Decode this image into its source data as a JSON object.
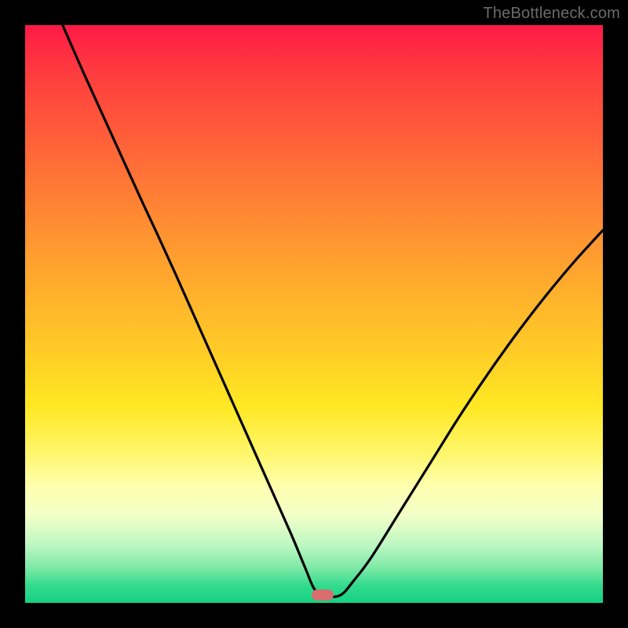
{
  "watermark": "TheBottleneck.com",
  "marker": {
    "cx_frac": 0.515,
    "cy_frac": 0.987
  },
  "chart_data": {
    "type": "line",
    "title": "",
    "xlabel": "",
    "ylabel": "",
    "xlim": [
      0,
      1
    ],
    "ylim": [
      0,
      1
    ],
    "grid": false,
    "legend": false,
    "note": "Axes are unlabeled; values are normalized fractions of the plot area (0=left/top, 1=right/bottom for rendering; bottleneck % interpreted as 1-y).",
    "series": [
      {
        "name": "bottleneck-curve",
        "x": [
          0.065,
          0.1,
          0.15,
          0.2,
          0.228,
          0.26,
          0.3,
          0.34,
          0.38,
          0.42,
          0.46,
          0.485,
          0.5,
          0.515,
          0.545,
          0.57,
          0.6,
          0.65,
          0.7,
          0.75,
          0.8,
          0.85,
          0.9,
          0.95,
          1.0
        ],
        "y": [
          0.0,
          0.08,
          0.19,
          0.3,
          0.36,
          0.43,
          0.52,
          0.61,
          0.7,
          0.79,
          0.88,
          0.94,
          0.975,
          0.987,
          0.987,
          0.96,
          0.92,
          0.84,
          0.76,
          0.68,
          0.605,
          0.535,
          0.47,
          0.41,
          0.355
        ]
      }
    ]
  },
  "colors": {
    "curve": "#000000",
    "marker": "#d96c6c",
    "background_frame": "#000000"
  }
}
